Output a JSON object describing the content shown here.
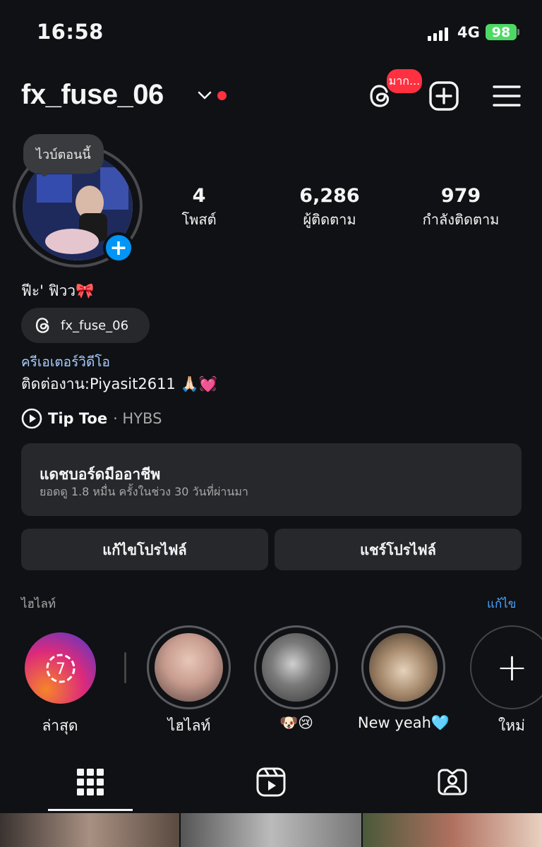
{
  "status_bar": {
    "time": "16:58",
    "network": "4G",
    "battery": "98"
  },
  "header": {
    "username": "fx_fuse_06",
    "threads_badge": "มาก..."
  },
  "profile": {
    "note": "ไวบ์ตอนนี้",
    "stats": [
      {
        "value": "4",
        "label": "โพสต์"
      },
      {
        "value": "6,286",
        "label": "ผู้ติดตาม"
      },
      {
        "value": "979",
        "label": "กำลังติดตาม"
      }
    ],
    "display_name": "ฟีะ' ฟิวว🎀",
    "threads_handle": "fx_fuse_06",
    "category": "ครีเอเตอร์วิดีโอ",
    "contact": "ติดต่องาน:Piyasit2611 🙏🏻💓",
    "music_title": "Tip Toe",
    "music_artist": "· HYBS"
  },
  "dashboard": {
    "title": "แดชบอร์ดมืออาชีพ",
    "subtitle": "ยอดดู 1.8 หมื่น ครั้งในช่วง 30 วันที่ผ่านมา"
  },
  "buttons": {
    "edit_profile": "แก้ไขโปรไฟล์",
    "share_profile": "แชร์โปรไฟล์"
  },
  "highlights": {
    "section_title": "ไฮไลท์",
    "edit_label": "แก้ไข",
    "latest_count": "7",
    "items": [
      {
        "label": "ล่าสุด"
      },
      {
        "label": "ไฮไลท์"
      },
      {
        "label": "🐶😢"
      },
      {
        "label": "New yeah🩵"
      },
      {
        "label": "ใหม่"
      }
    ]
  },
  "icons": {
    "threads": "threads-icon",
    "create": "plus-square-icon",
    "menu": "hamburger-menu-icon",
    "grid": "grid-icon",
    "reels": "reels-icon",
    "tagged": "tagged-person-icon"
  }
}
